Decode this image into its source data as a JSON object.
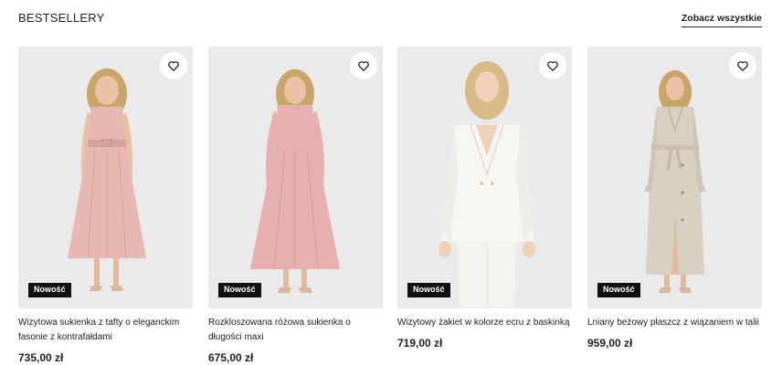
{
  "section": {
    "title": "BESTSELLERY",
    "see_all_label": "Zobacz wszystkie"
  },
  "products": [
    {
      "name": "Wizytowa sukienka z tafty o eleganckim fasonie z kontrafałdami",
      "price": "735,00 zł",
      "badge": "Nowość",
      "favorite_icon": "heart-outline-icon",
      "image_color": "#e8b7b2"
    },
    {
      "name": "Rozkloszowana różowa sukienka o długości maxi",
      "price": "675,00 zł",
      "badge": "Nowość",
      "favorite_icon": "heart-outline-icon",
      "image_color": "#e6b0ae"
    },
    {
      "name": "Wizytowy żakiet w kolorze ecru z baskinką",
      "price": "719,00 zł",
      "badge": "Nowość",
      "favorite_icon": "heart-outline-icon",
      "image_color": "#f7f6f2"
    },
    {
      "name": "Lniany beżowy płaszcz z wiązaniem w talii",
      "price": "959,00 zł",
      "badge": "Nowość",
      "favorite_icon": "heart-outline-icon",
      "image_color": "#d9d0c4"
    }
  ]
}
